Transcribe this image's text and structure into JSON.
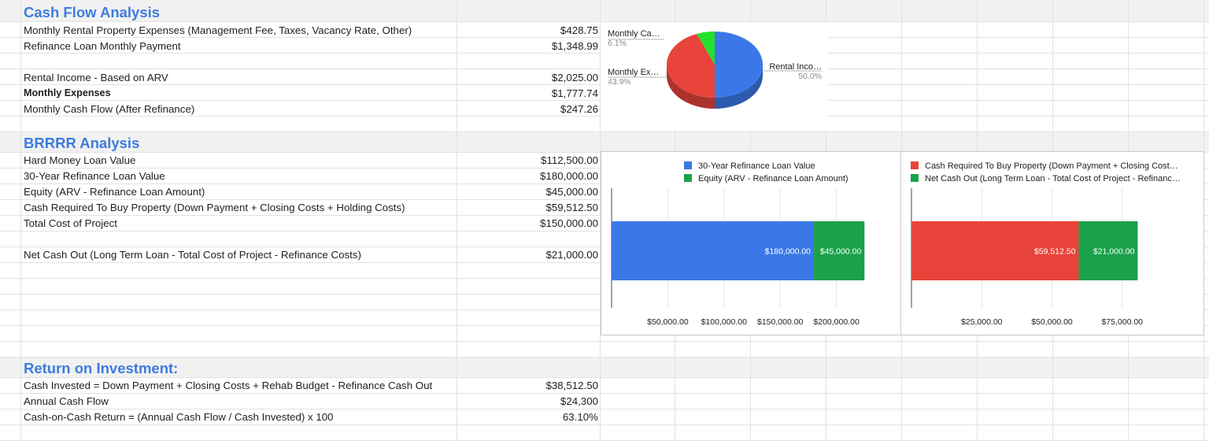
{
  "cash_flow": {
    "title": "Cash Flow Analysis",
    "rows": [
      {
        "label": "Monthly Rental Property Expenses (Management Fee, Taxes, Vacancy Rate, Other)",
        "value": "$428.75"
      },
      {
        "label": "Refinance Loan Monthly Payment",
        "value": "$1,348.99"
      },
      {
        "label": "Rental Income - Based on ARV",
        "value": "$2,025.00"
      },
      {
        "label": "Monthly Expenses",
        "value": "$1,777.74"
      },
      {
        "label": "Monthly Cash Flow (After Refinance)",
        "value": "$247.26"
      }
    ]
  },
  "brrrr": {
    "title": "BRRRR Analysis",
    "rows": [
      {
        "label": "Hard Money Loan Value",
        "value": "$112,500.00"
      },
      {
        "label": "30-Year Refinance Loan Value",
        "value": "$180,000.00"
      },
      {
        "label": "Equity (ARV - Refinance Loan Amount)",
        "value": "$45,000.00"
      },
      {
        "label": "Cash Required To Buy Property (Down Payment + Closing Costs + Holding Costs)",
        "value": "$59,512.50"
      },
      {
        "label": "Total Cost of Project",
        "value": "$150,000.00"
      },
      {
        "label": "Net Cash Out (Long Term Loan - Total Cost of Project - Refinance Costs)",
        "value": "$21,000.00"
      }
    ]
  },
  "roi": {
    "title": "Return on Investment:",
    "rows": [
      {
        "label": "Cash Invested = Down Payment + Closing Costs + Rehab Budget - Refinance Cash Out",
        "value": "$38,512.50"
      },
      {
        "label": "Annual Cash Flow",
        "value": "$24,300"
      },
      {
        "label": "Cash-on-Cash Return = (Annual Cash Flow / Cash Invested) x 100",
        "value": "63.10%"
      }
    ]
  },
  "colors": {
    "blue": "#3b78e7",
    "red": "#e8433a",
    "green": "#1aa24a",
    "lime": "#23e02c",
    "title_blue": "#3d7be0"
  },
  "chart_data": [
    {
      "type": "pie",
      "slices": [
        {
          "label": "Rental Inco…",
          "value": 50.0,
          "percent_label": "50.0%",
          "color": "#3b78e7"
        },
        {
          "label": "Monthly Ex…",
          "value": 43.9,
          "percent_label": "43.9%",
          "color": "#e8433a"
        },
        {
          "label": "Monthly Ca…",
          "value": 6.1,
          "percent_label": "6.1%",
          "color": "#23e02c"
        }
      ]
    },
    {
      "type": "bar",
      "orientation": "horizontal",
      "stacked": true,
      "series": [
        {
          "name": "30-Year Refinance Loan Value",
          "values": [
            180000
          ],
          "data_label": "$180,000.00",
          "color": "#3b78e7"
        },
        {
          "name": "Equity (ARV - Refinance Loan Amount)",
          "values": [
            45000
          ],
          "data_label": "$45,000.00",
          "color": "#1aa24a"
        }
      ],
      "xlim": [
        0,
        250000
      ],
      "x_ticks": [
        50000,
        100000,
        150000,
        200000
      ],
      "x_tick_labels": [
        "$50,000.00",
        "$100,000.00",
        "$150,000.00",
        "$200,000.00"
      ],
      "legend_position": "top"
    },
    {
      "type": "bar",
      "orientation": "horizontal",
      "stacked": true,
      "series": [
        {
          "name": "Cash Required To Buy Property (Down Payment + Closing Cost…",
          "values": [
            59512.5
          ],
          "data_label": "$59,512.50",
          "color": "#e8433a"
        },
        {
          "name": "Net Cash Out (Long Term Loan - Total Cost of Project - Refinanc…",
          "values": [
            21000
          ],
          "data_label": "$21,000.00",
          "color": "#1aa24a"
        }
      ],
      "xlim": [
        0,
        100000
      ],
      "x_ticks": [
        25000,
        50000,
        75000
      ],
      "x_tick_labels": [
        "$25,000.00",
        "$50,000.00",
        "$75,000.00"
      ],
      "legend_position": "top"
    }
  ]
}
